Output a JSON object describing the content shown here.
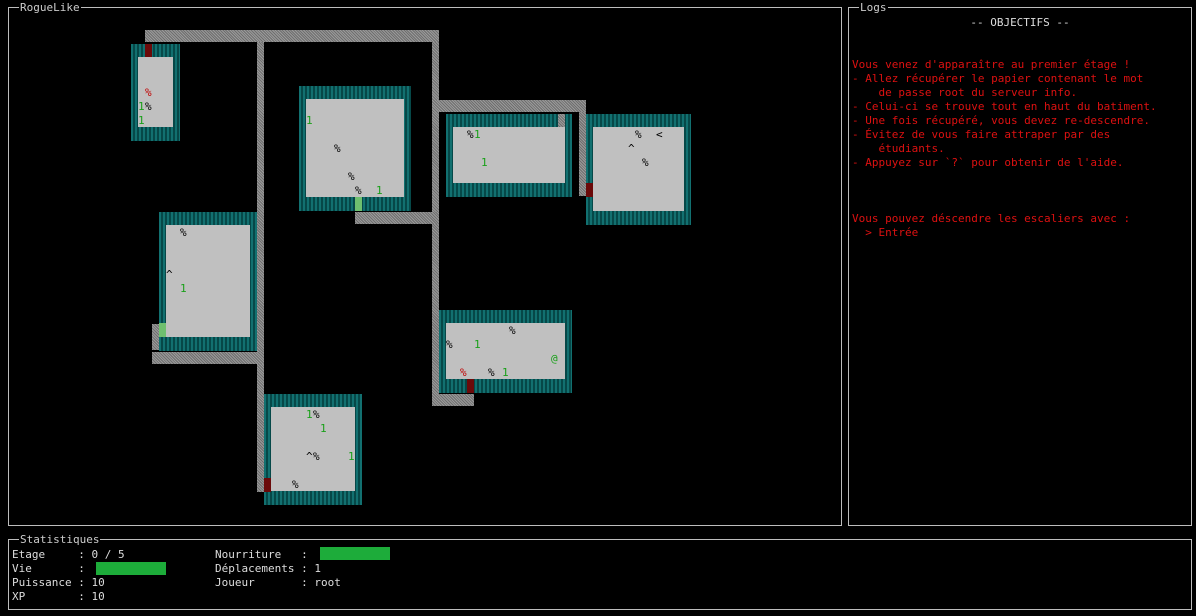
{
  "map": {
    "title": "RogueLike",
    "glyphs": {
      "food": "%",
      "potion": "1",
      "trap": "^",
      "stairs": "<",
      "player": "@"
    }
  },
  "logs": {
    "title": "Logs",
    "heading": "-- OBJECTIFS --",
    "lines": [
      "Vous venez d'apparaître au premier étage !",
      "- Allez récupérer le papier contenant le mot",
      "    de passe root du serveur info.",
      "- Celui-ci se trouve tout en haut du batiment.",
      "- Une fois récupéré, vous devez re-descendre.",
      "- Évitez de vous faire attraper par des",
      "    étudiants.",
      "- Appuyez sur `?` pour obtenir de l'aide.",
      "Vous pouvez déscendre les escaliers avec :",
      "  > Entrée"
    ]
  },
  "stats": {
    "title": "Statistiques",
    "etage": "Etage     : 0 / 5",
    "vie": "Vie       :",
    "puissance": "Puissance : 10",
    "xp": "XP        : 10",
    "nourriture": "Nourriture   :",
    "deplacements": "Déplacements : 1",
    "joueur": "Joueur       : root",
    "vie_level": 1.0,
    "nourriture_level": 1.0,
    "bar_color": "#1dac3a"
  },
  "colors": {
    "wall": "#0b5b5b",
    "floor": "#c0c0c0",
    "corridor": "#888888",
    "door": "#6b0a0a",
    "log_text": "#dd1111",
    "potion": "#19a019"
  }
}
